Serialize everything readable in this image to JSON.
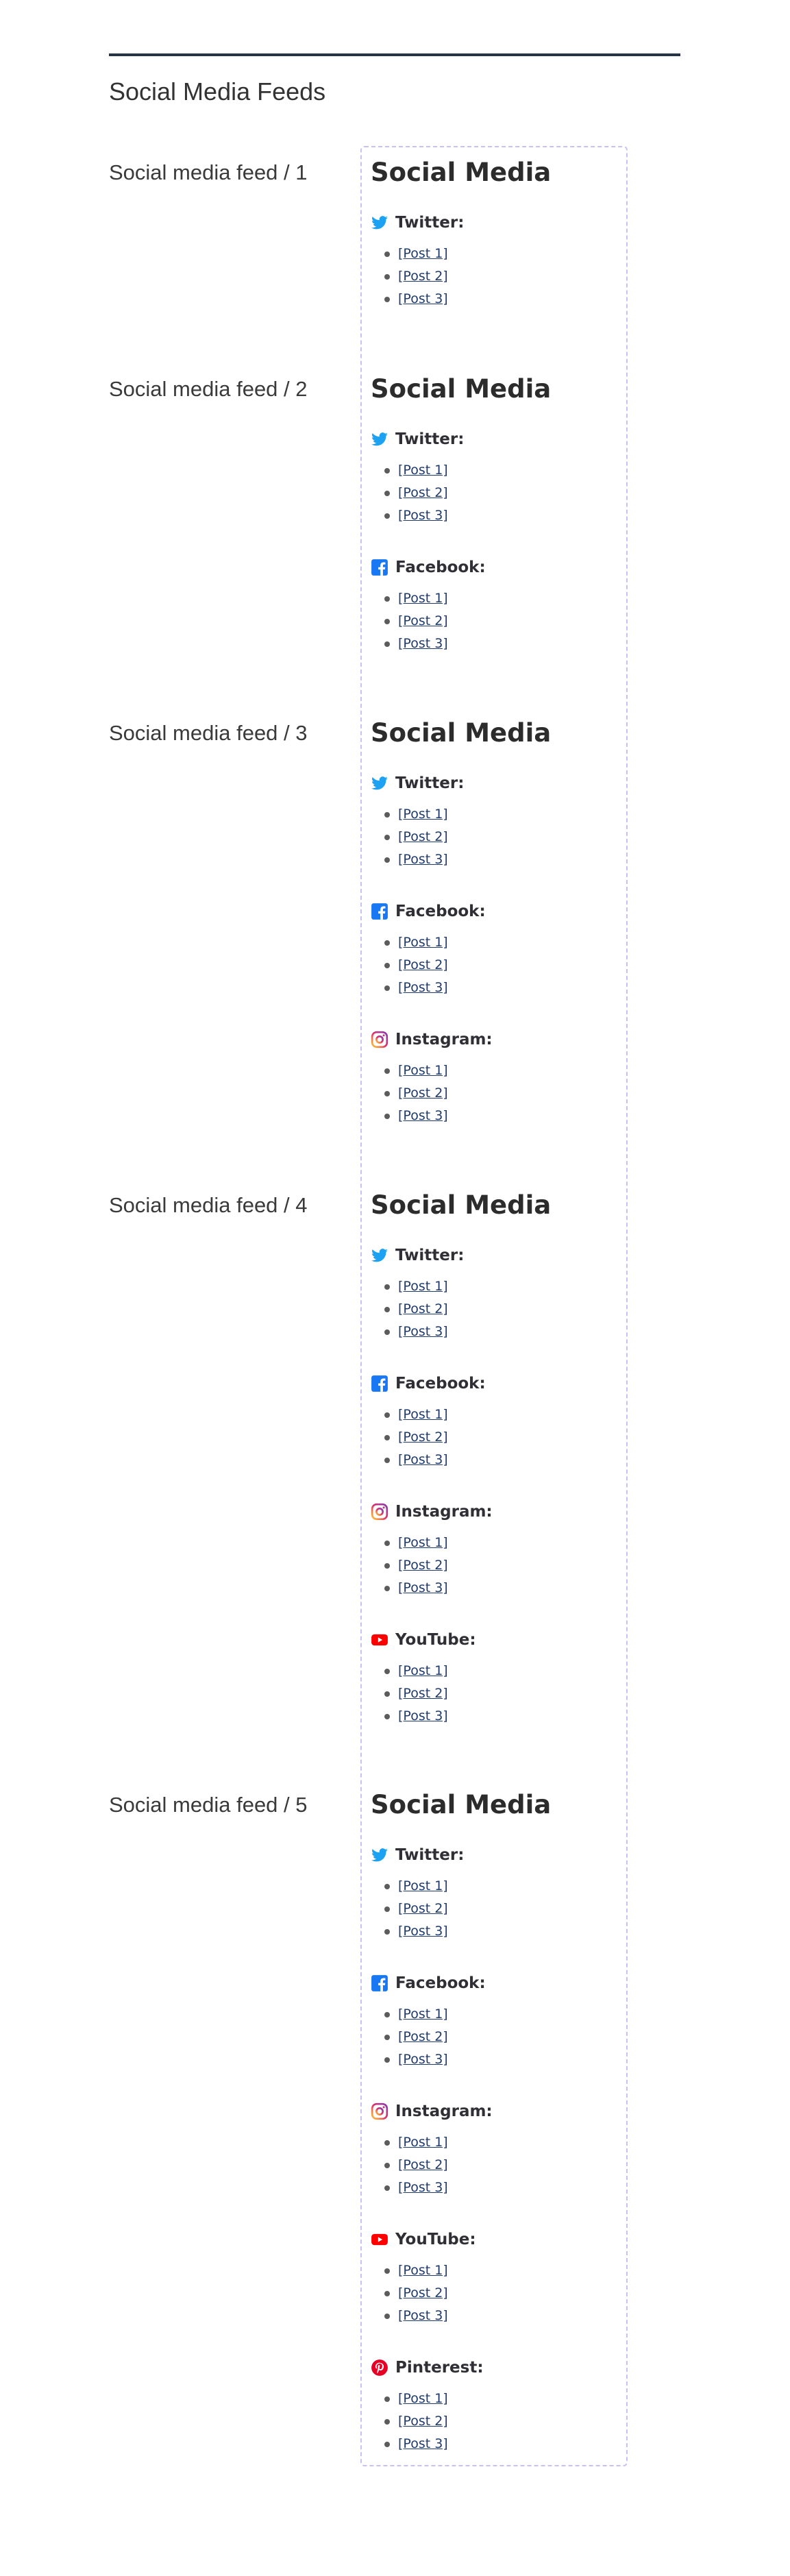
{
  "page": {
    "heading": "Social Media Feeds"
  },
  "widget_title": "Social Media",
  "networks": {
    "twitter": {
      "label": "Twitter:",
      "icon": "twitter-bird-icon",
      "color": "#1da1f2"
    },
    "facebook": {
      "label": "Facebook:",
      "icon": "facebook-icon",
      "color": "#1877f2"
    },
    "instagram": {
      "label": "Instagram:",
      "icon": "instagram-icon",
      "color": "#d6249f"
    },
    "youtube": {
      "label": "YouTube:",
      "icon": "youtube-icon",
      "color": "#ff0000"
    },
    "pinterest": {
      "label": "Pinterest:",
      "icon": "pinterest-icon",
      "color": "#e60023"
    }
  },
  "posts": [
    "[Post 1]",
    "[Post 2]",
    "[Post 3]"
  ],
  "feeds": [
    {
      "label": "Social media feed / 1",
      "networks": [
        "twitter"
      ]
    },
    {
      "label": "Social media feed / 2",
      "networks": [
        "twitter",
        "facebook"
      ]
    },
    {
      "label": "Social media feed / 3",
      "networks": [
        "twitter",
        "facebook",
        "instagram"
      ]
    },
    {
      "label": "Social media feed / 4",
      "networks": [
        "twitter",
        "facebook",
        "instagram",
        "youtube"
      ]
    },
    {
      "label": "Social media feed / 5",
      "networks": [
        "twitter",
        "facebook",
        "instagram",
        "youtube",
        "pinterest"
      ]
    }
  ]
}
